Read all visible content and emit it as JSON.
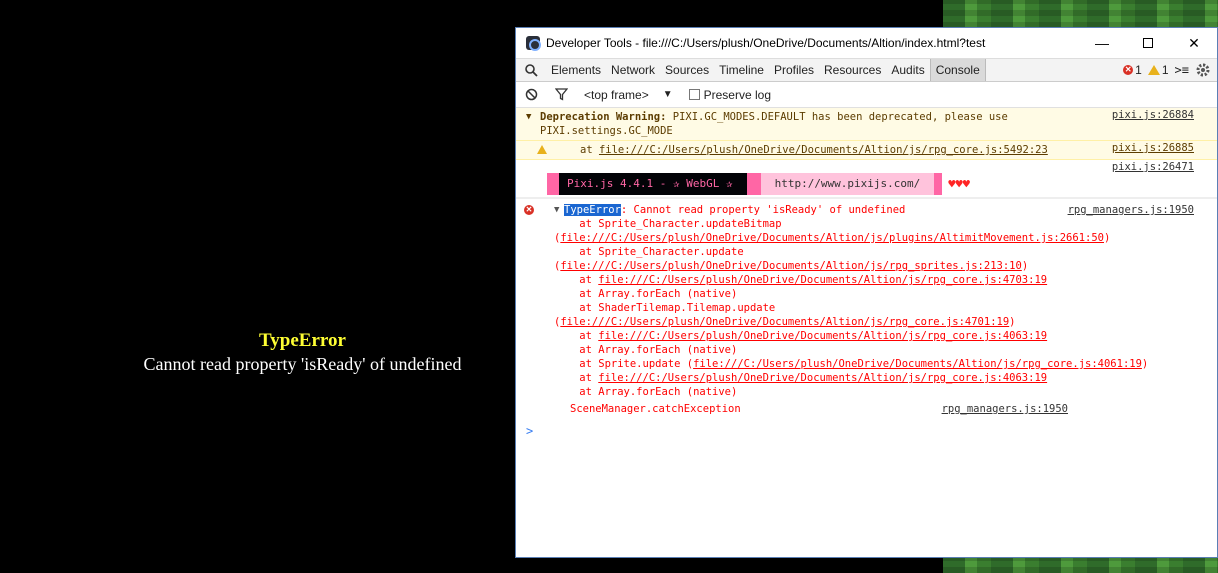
{
  "game": {
    "error_title": "TypeError",
    "error_message": "Cannot read property 'isReady' of undefined"
  },
  "devtools": {
    "title": "Developer Tools - file:///C:/Users/plush/OneDrive/Documents/Altion/index.html?test",
    "tabs": [
      "Elements",
      "Network",
      "Sources",
      "Timeline",
      "Profiles",
      "Resources",
      "Audits",
      "Console"
    ],
    "active_tab": "Console",
    "error_count": "1",
    "warning_count": "1",
    "frame_selector": "<top frame>",
    "preserve_log_label": "Preserve log",
    "preserve_log_checked": false
  },
  "console": {
    "warning": {
      "label": "Deprecation Warning:",
      "text": " PIXI.GC_MODES.DEFAULT has been deprecated, please use",
      "text2": "PIXI.settings.GC_MODE",
      "source": "pixi.js:26884",
      "trace_prefix": "at ",
      "trace_link": "file:///C:/Users/plush/OneDrive/Documents/Altion/js/rpg_core.js:5492:23",
      "trace_source": "pixi.js:26885"
    },
    "pixi": {
      "source": "pixi.js:26471",
      "banner": "Pixi.js 4.4.1 - ✰ WebGL ✰",
      "url": "http://www.pixijs.com/",
      "hearts": "♥♥♥"
    },
    "error": {
      "type": "TypeError",
      "message": ": Cannot read property 'isReady' of undefined",
      "source": "rpg_managers.js:1950",
      "trace": [
        {
          "text": "    at Sprite_Character.updateBitmap",
          "link": "",
          "suffix": ""
        },
        {
          "text": "(",
          "link": "file:///C:/Users/plush/OneDrive/Documents/Altion/js/plugins/AltimitMovement.js:2661:50",
          "suffix": ")",
          "plain_link": true
        },
        {
          "text": "    at Sprite_Character.update",
          "link": "",
          "suffix": ""
        },
        {
          "text": "(",
          "link": "file:///C:/Users/plush/OneDrive/Documents/Altion/js/rpg_sprites.js:213:10",
          "suffix": ")"
        },
        {
          "text": "    at ",
          "link": "file:///C:/Users/plush/OneDrive/Documents/Altion/js/rpg_core.js:4703:19",
          "suffix": ""
        },
        {
          "text": "    at Array.forEach (native)",
          "link": "",
          "suffix": ""
        },
        {
          "text": "    at ShaderTilemap.Tilemap.update",
          "link": "",
          "suffix": ""
        },
        {
          "text": "(",
          "link": "file:///C:/Users/plush/OneDrive/Documents/Altion/js/rpg_core.js:4701:19",
          "suffix": ")"
        },
        {
          "text": "    at ",
          "link": "file:///C:/Users/plush/OneDrive/Documents/Altion/js/rpg_core.js:4063:19",
          "suffix": ""
        },
        {
          "text": "    at Array.forEach (native)",
          "link": "",
          "suffix": ""
        },
        {
          "text": "    at Sprite.update (",
          "link": "file:///C:/Users/plush/OneDrive/Documents/Altion/js/rpg_core.js:4061:19",
          "suffix": ")"
        },
        {
          "text": "    at ",
          "link": "file:///C:/Users/plush/OneDrive/Documents/Altion/js/rpg_core.js:4063:19",
          "suffix": ""
        },
        {
          "text": "    at Array.forEach (native)",
          "link": "",
          "suffix": ""
        }
      ],
      "catch_text": "SceneManager.catchException",
      "catch_source": "rpg_managers.js:1950"
    },
    "prompt": ">"
  },
  "colors": {
    "error": "#ff0000",
    "warning_bg": "#fffbe5",
    "pixi_pink": "#ff66a5",
    "window_border": "#5a7fb5"
  }
}
